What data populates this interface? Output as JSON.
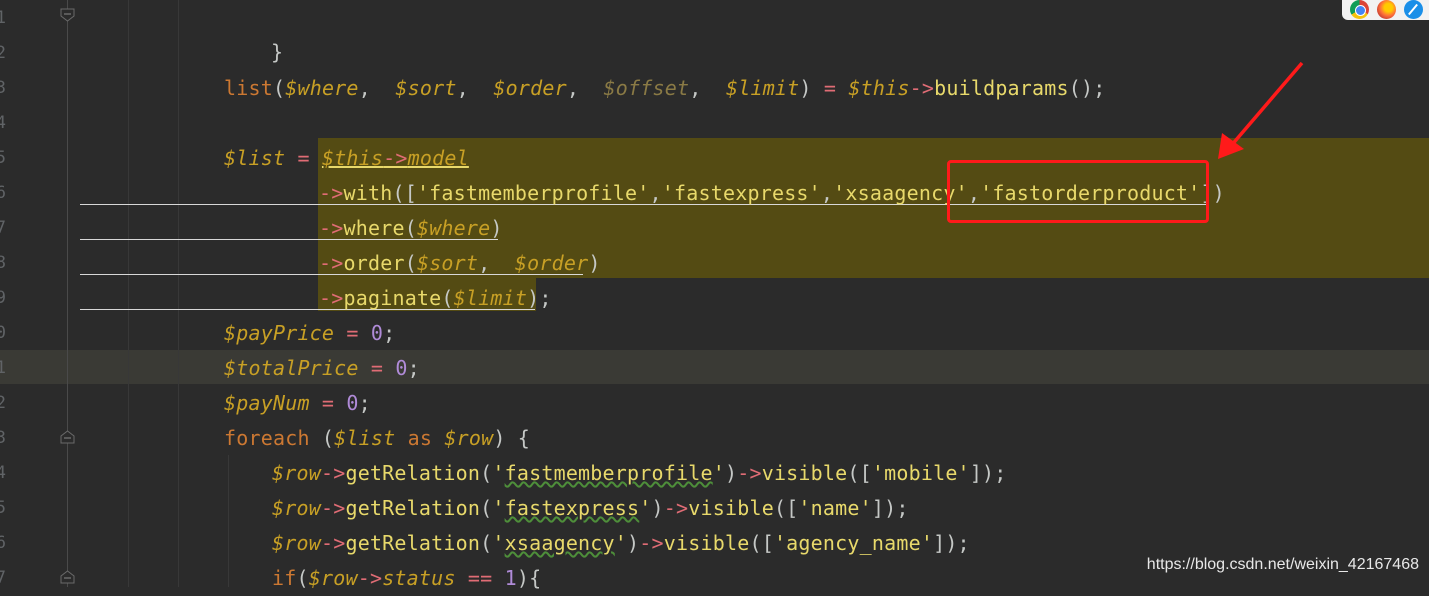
{
  "editor": {
    "line_numbers": [
      "1",
      "2",
      "3",
      "4",
      "5",
      "6",
      "7",
      "8",
      "9",
      "0",
      "1",
      "2",
      "3",
      "4",
      "5",
      "6",
      "7"
    ],
    "lines": {
      "l1": {
        "brace": "}"
      },
      "l3": {
        "fn": "list",
        "p1": "(",
        "v1": "$where",
        "c1": ",  ",
        "v2": "$sort",
        "c2": ",  ",
        "v3": "$order",
        "c3": ",  ",
        "v4": "$offset",
        "c4": ",  ",
        "v5": "$limit",
        "p2": ")",
        "eq": " = ",
        "v6": "$this",
        "arrow": "->",
        "m": "buildparams",
        "end": "();"
      },
      "l5": {
        "v1": "$list",
        "eq": " = ",
        "v2": "$this",
        "arrow": "->",
        "m": "model"
      },
      "l6": {
        "arrow": "->",
        "m": "with",
        "p1": "([",
        "s1": "'fastmemberprofile'",
        "c1": ",",
        "s2": "'fastexpress'",
        "c2": ",",
        "s3": "'xsaagency'",
        "c3": ",",
        "s4": "'fastorderproduct'",
        "end": "])"
      },
      "l7": {
        "arrow": "->",
        "m": "where",
        "p1": "(",
        "v": "$where",
        "p2": ")"
      },
      "l8": {
        "arrow": "->",
        "m": "order",
        "p1": "(",
        "v1": "$sort",
        "c": ",  ",
        "v2": "$order",
        "p2": ")"
      },
      "l9": {
        "arrow": "->",
        "m": "paginate",
        "p1": "(",
        "v": "$limit",
        "p2": ")",
        "end": ";"
      },
      "l10": {
        "v": "$payPrice",
        "eq": " = ",
        "n": "0",
        "end": ";"
      },
      "l11": {
        "v": "$totalPrice",
        "eq": " = ",
        "n": "0",
        "end": ";"
      },
      "l12": {
        "v": "$payNum",
        "eq": " = ",
        "n": "0",
        "end": ";"
      },
      "l13": {
        "kw1": "foreach",
        "p1": " (",
        "v1": "$list",
        "kw2": " as ",
        "v2": "$row",
        "end": ") {"
      },
      "l14": {
        "v": "$row",
        "arrow": "->",
        "m": "getRelation",
        "p1": "(",
        "q1": "'",
        "s": "fastmemberprofile",
        "q2": "'",
        "p2": ")",
        "arrow2": "->",
        "m2": "visible",
        "p3": "([",
        "s2": "'mobile'",
        "end": "]);"
      },
      "l15": {
        "v": "$row",
        "arrow": "->",
        "m": "getRelation",
        "p1": "(",
        "q1": "'",
        "s": "fastexpress",
        "q2": "'",
        "p2": ")",
        "arrow2": "->",
        "m2": "visible",
        "p3": "([",
        "s2": "'name'",
        "end": "]);"
      },
      "l16": {
        "v": "$row",
        "arrow": "->",
        "m": "getRelation",
        "p1": "(",
        "q1": "'",
        "s": "xsaagency",
        "q2": "'",
        "p2": ")",
        "arrow2": "->",
        "m2": "visible",
        "p3": "([",
        "s2": "'agency_name'",
        "end": "]);"
      },
      "l17": {
        "kw": "if",
        "p1": "(",
        "v": "$row",
        "arrow": "->",
        "prop": "status",
        "eq": " == ",
        "n": "1",
        "end": "){"
      }
    }
  },
  "watermark": "https://blog.csdn.net/weixin_42167468",
  "colors": {
    "background": "#2b2b2b",
    "highlight": "#544b13",
    "annotation": "#ff1a1a"
  },
  "icons": [
    "chrome-icon",
    "firefox-icon",
    "safari-icon",
    "fold-icon",
    "annotation-arrow-icon"
  ]
}
